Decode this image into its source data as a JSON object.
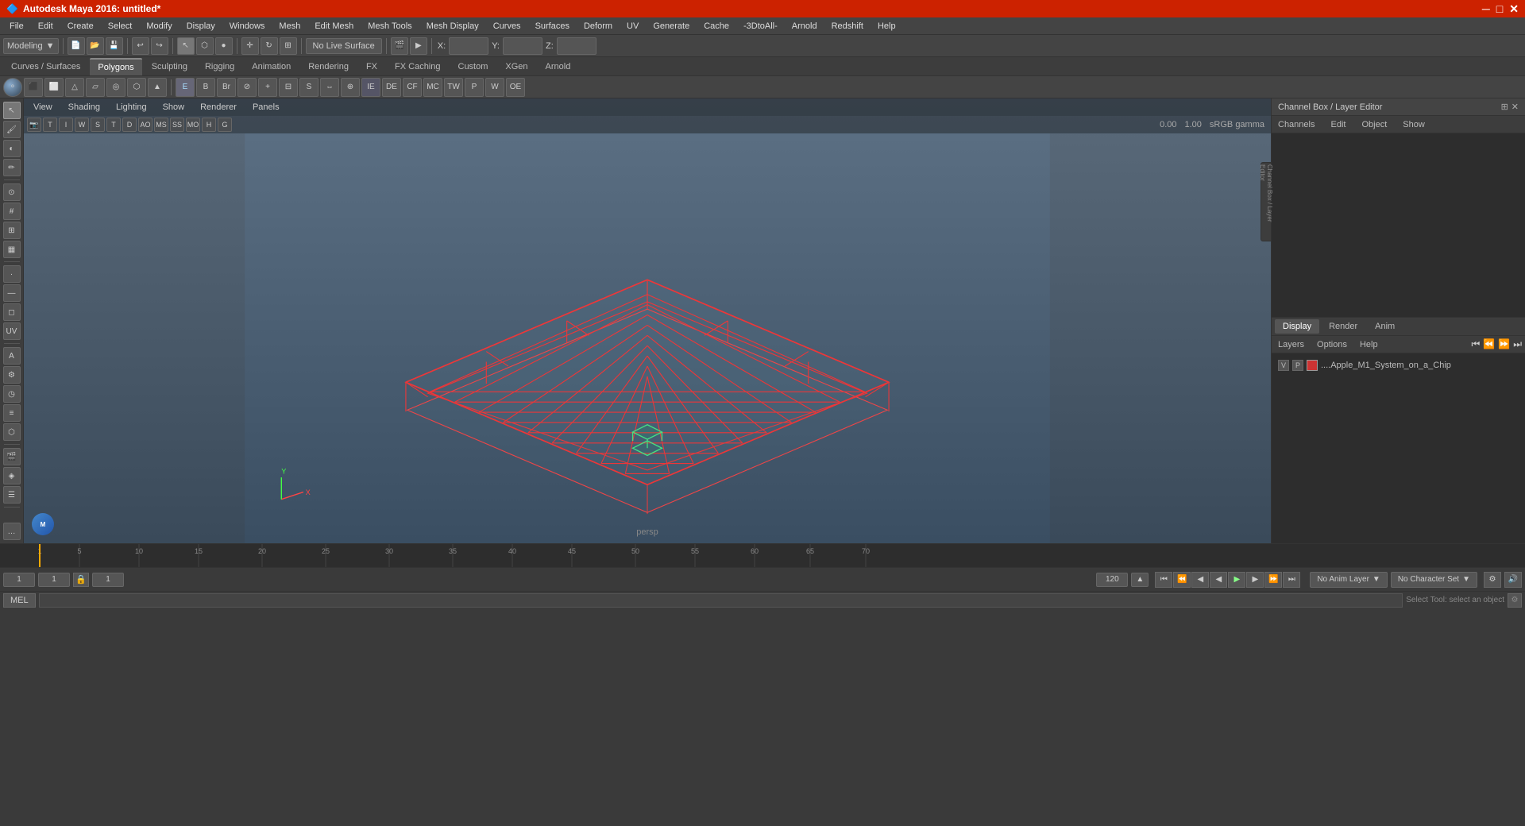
{
  "window": {
    "title": "Autodesk Maya 2016: untitled*",
    "min_btn": "─",
    "max_btn": "□",
    "close_btn": "✕"
  },
  "menu": {
    "items": [
      "File",
      "Edit",
      "Create",
      "Select",
      "Modify",
      "Display",
      "Windows",
      "Mesh",
      "Edit Mesh",
      "Mesh Tools",
      "Mesh Display",
      "Curves",
      "Surfaces",
      "Deform",
      "UV",
      "Generate",
      "Cache",
      "-3DtoAll-",
      "Arnold",
      "Redshift",
      "Help"
    ]
  },
  "toolbar1": {
    "mode_dropdown": "Modeling",
    "no_live_surface": "No Live Surface",
    "x_label": "X:",
    "y_label": "Y:",
    "z_label": "Z:"
  },
  "tabs": {
    "items": [
      "Curves / Surfaces",
      "Polygons",
      "Sculpting",
      "Rigging",
      "Animation",
      "Rendering",
      "FX",
      "FX Caching",
      "Custom",
      "XGen",
      "Arnold"
    ]
  },
  "viewport": {
    "menus": [
      "View",
      "Shading",
      "Lighting",
      "Show",
      "Renderer",
      "Panels"
    ],
    "label": "persp",
    "gamma_label": "sRGB gamma"
  },
  "channel_box": {
    "title": "Channel Box / Layer Editor",
    "nav": [
      "Channels",
      "Edit",
      "Object",
      "Show"
    ]
  },
  "dra_tabs": {
    "items": [
      "Display",
      "Render",
      "Anim"
    ],
    "active": "Display",
    "nav_items": [
      "Layers",
      "Options",
      "Help"
    ]
  },
  "layer": {
    "v": "V",
    "p": "P",
    "color": "#cc3333",
    "name": "....Apple_M1_System_on_a_Chip"
  },
  "timeline": {
    "start": "1",
    "end": "120",
    "current": "1",
    "range_start": "1",
    "range_end": "120",
    "anim_layer": "No Anim Layer",
    "char_set": "No Character Set"
  },
  "playback": {
    "skip_start": "⏮",
    "prev_key": "⏪",
    "prev_frame": "◀",
    "play_back": "▶",
    "play_fwd": "▶",
    "next_frame": "▶",
    "next_key": "⏩",
    "skip_end": "⏭"
  },
  "status_bar": {
    "mel_label": "MEL",
    "status_text": "Select Tool: select an object"
  },
  "icons": {
    "select": "↖",
    "lasso": "◉",
    "move": "✛",
    "rotate": "↻",
    "scale": "⊞",
    "snap": "⊙",
    "history": "◁",
    "redo": "▷"
  }
}
